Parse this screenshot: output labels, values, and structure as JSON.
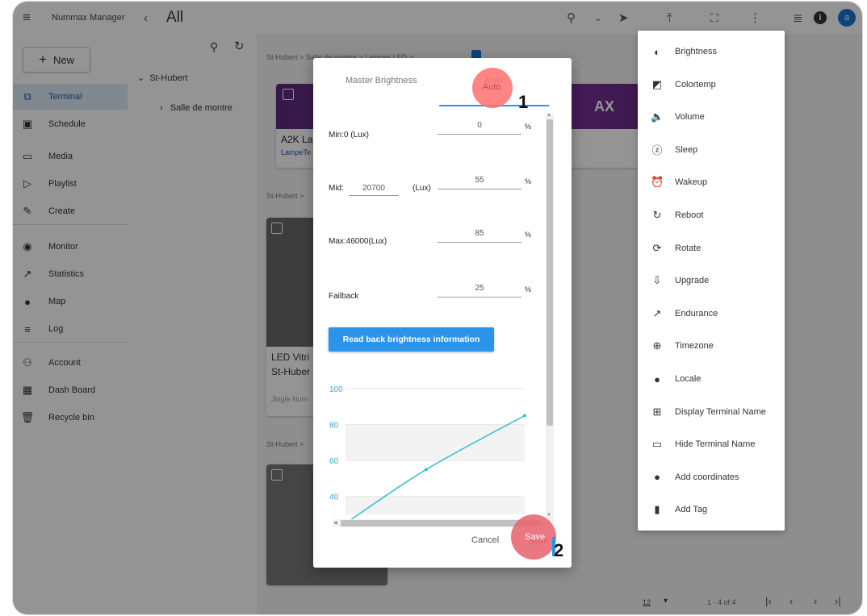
{
  "app": {
    "title": "Nummax Manager",
    "view": "All"
  },
  "sidebar": {
    "new_label": "New",
    "items": [
      {
        "label": "Terminal",
        "icon": "cast-icon",
        "glyph": "⧉",
        "active": true
      },
      {
        "label": "Schedule",
        "icon": "calendar-icon",
        "glyph": "▣"
      },
      {
        "label": "Media",
        "icon": "media-icon",
        "glyph": "▭"
      },
      {
        "label": "Playlist",
        "icon": "playlist-icon",
        "glyph": "▷"
      },
      {
        "label": "Create",
        "icon": "pencil-icon",
        "glyph": "✎"
      },
      {
        "label": "Monitor",
        "icon": "eye-icon",
        "glyph": "◉"
      },
      {
        "label": "Statistics",
        "icon": "trend-icon",
        "glyph": "↗"
      },
      {
        "label": "Map",
        "icon": "pin-icon",
        "glyph": "●"
      },
      {
        "label": "Log",
        "icon": "list-icon",
        "glyph": "≡"
      },
      {
        "label": "Account",
        "icon": "person-icon",
        "glyph": "⚇"
      },
      {
        "label": "Dash Board",
        "icon": "dashboard-icon",
        "glyph": "▦"
      },
      {
        "label": "Recycle bin",
        "icon": "trash-icon",
        "glyph": "🗑"
      }
    ]
  },
  "tree": {
    "root": "St-Hubert",
    "child": "Salle de montre"
  },
  "content": {
    "breadcrumb1": "St-Hubert  >  Salle de montre  >  Lampes LED  >",
    "breadcrumb2": "St-Hubert  >",
    "breadcrumb3": "St-Hubert  >",
    "card1_title": "A2K La",
    "card1_sub": "LampeTe",
    "card1_banner": "AX",
    "card2_title": "LED Vitri",
    "card2_sub": "St-Huber",
    "card2_meta": "Jingle Num",
    "pagination": {
      "per_page": "12",
      "range": "1 - 4 of 4"
    }
  },
  "menu": {
    "items": [
      {
        "label": "Brightness",
        "icon": "brightness-icon",
        "glyph": "◐"
      },
      {
        "label": "Colortemp",
        "icon": "colortemp-icon",
        "glyph": "◩"
      },
      {
        "label": "Volume",
        "icon": "volume-icon",
        "glyph": "🔈"
      },
      {
        "label": "Sleep",
        "icon": "sleep-icon",
        "glyph": "ⓩ"
      },
      {
        "label": "Wakeup",
        "icon": "alarm-icon",
        "glyph": "⏰"
      },
      {
        "label": "Reboot",
        "icon": "reboot-icon",
        "glyph": "↻"
      },
      {
        "label": "Rotate",
        "icon": "rotate-icon",
        "glyph": "⟳"
      },
      {
        "label": "Upgrade",
        "icon": "upgrade-icon",
        "glyph": "⇩"
      },
      {
        "label": "Endurance",
        "icon": "endurance-icon",
        "glyph": "↗"
      },
      {
        "label": "Timezone",
        "icon": "globe-icon",
        "glyph": "⊕"
      },
      {
        "label": "Locale",
        "icon": "locale-icon",
        "glyph": "●"
      },
      {
        "label": "Display Terminal Name",
        "icon": "display-name-icon",
        "glyph": "⊞"
      },
      {
        "label": "Hide Terminal Name",
        "icon": "hide-name-icon",
        "glyph": "▭"
      },
      {
        "label": "Add coordinates",
        "icon": "pin-icon",
        "glyph": "●"
      },
      {
        "label": "Add Tag",
        "icon": "bookmark-icon",
        "glyph": "▮"
      }
    ]
  },
  "dialog": {
    "tab_master": "Master Brightness",
    "tab_auto": "Auto",
    "min_label": "Min:0 (Lux)",
    "min_value": "0",
    "mid_label": "Mid:",
    "mid_lux": "20700",
    "mid_unit": "(Lux)",
    "mid_value": "55",
    "max_label": "Max:46000(Lux)",
    "max_value": "85",
    "failback_label": "Failback",
    "failback_value": "25",
    "percent": "%",
    "read_button": "Read back brightness information",
    "cancel": "Cancel",
    "save": "Save"
  },
  "markers": {
    "one": "1",
    "two": "2"
  },
  "chart_data": {
    "type": "line",
    "ylim": [
      30,
      100
    ],
    "yticks": [
      "100",
      "80",
      "60",
      "40"
    ],
    "x": [
      0,
      20700,
      46000
    ],
    "values": [
      25,
      55,
      85
    ],
    "color": "#3ec1d3"
  },
  "colors": {
    "accent": "#2b94e8",
    "highlight": "#ff6e6e"
  }
}
